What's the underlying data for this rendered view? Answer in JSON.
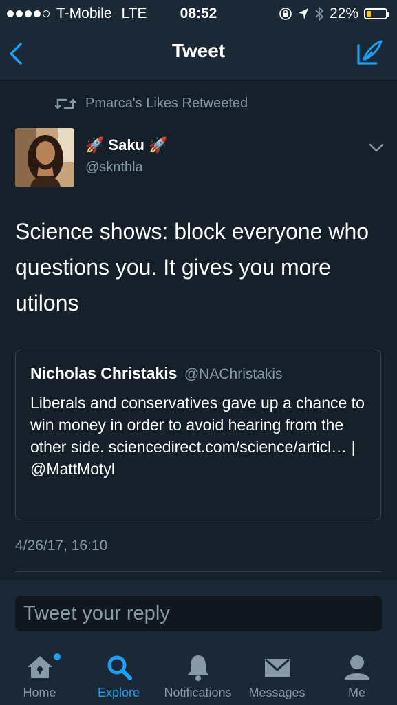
{
  "status_bar": {
    "carrier": "T-Mobile",
    "network": "LTE",
    "time": "08:52",
    "battery": "22%",
    "battery_level": 0.22,
    "battery_color": "#f5c518"
  },
  "nav": {
    "title": "Tweet",
    "back_icon": "chevron-left-icon",
    "compose_icon": "compose-tweet-icon"
  },
  "tweet": {
    "retweeted_by": "Pmarca's Likes Retweeted",
    "author_name": "Saku",
    "author_emoji": "🚀",
    "author_handle": "@sknthla",
    "text": "Science shows: block everyone who questions you. It gives you more utilons",
    "quoted": {
      "name": "Nicholas Christakis",
      "handle": "@NAChristakis",
      "text": "Liberals and conservatives gave up a chance to win money in order to avoid hearing from the other side. sciencedirect.com/science/articl… | @MattMotyl"
    },
    "timestamp": "4/26/17, 16:10"
  },
  "reply": {
    "placeholder": "Tweet your reply"
  },
  "tabs": [
    {
      "label": "Home",
      "icon": "home-icon",
      "active": false
    },
    {
      "label": "Explore",
      "icon": "search-icon",
      "active": true
    },
    {
      "label": "Notifications",
      "icon": "bell-icon",
      "active": false
    },
    {
      "label": "Messages",
      "icon": "envelope-icon",
      "active": false
    },
    {
      "label": "Me",
      "icon": "person-icon",
      "active": false
    }
  ],
  "colors": {
    "background": "#15202b",
    "bar": "#1b2836",
    "accent": "#1da1f2",
    "muted": "#8899a6"
  }
}
